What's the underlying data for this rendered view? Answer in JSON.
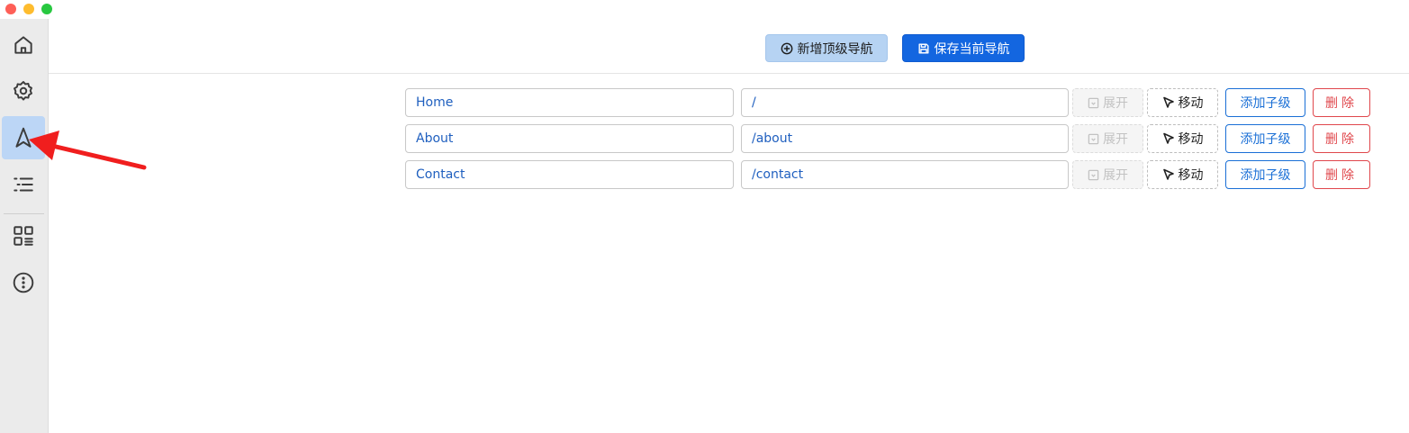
{
  "window": {
    "controls": [
      "close",
      "minimize",
      "zoom"
    ]
  },
  "sidebar": {
    "items": [
      {
        "icon": "home-icon",
        "active": false
      },
      {
        "icon": "gear-icon",
        "active": false
      },
      {
        "icon": "navigation-icon",
        "active": true
      },
      {
        "icon": "list-icon",
        "active": false
      },
      {
        "icon": "grid-icon",
        "active": false
      },
      {
        "icon": "more-icon",
        "active": false
      }
    ]
  },
  "toolbar": {
    "add_label": "新增顶级导航",
    "save_label": "保存当前导航"
  },
  "nav_rows": [
    {
      "name": "Home",
      "path": "/",
      "expand_label": "展开",
      "move_label": "移动",
      "add_child_label": "添加子级",
      "delete_label": "删除"
    },
    {
      "name": "About",
      "path": "/about",
      "expand_label": "展开",
      "move_label": "移动",
      "add_child_label": "添加子级",
      "delete_label": "删除"
    },
    {
      "name": "Contact",
      "path": "/contact",
      "expand_label": "展开",
      "move_label": "移动",
      "add_child_label": "添加子级",
      "delete_label": "删除"
    }
  ],
  "colors": {
    "primary": "#1366e0",
    "primary_light": "#b6d3f3",
    "danger": "#e0474c",
    "annotation_arrow": "#f01e1e"
  }
}
